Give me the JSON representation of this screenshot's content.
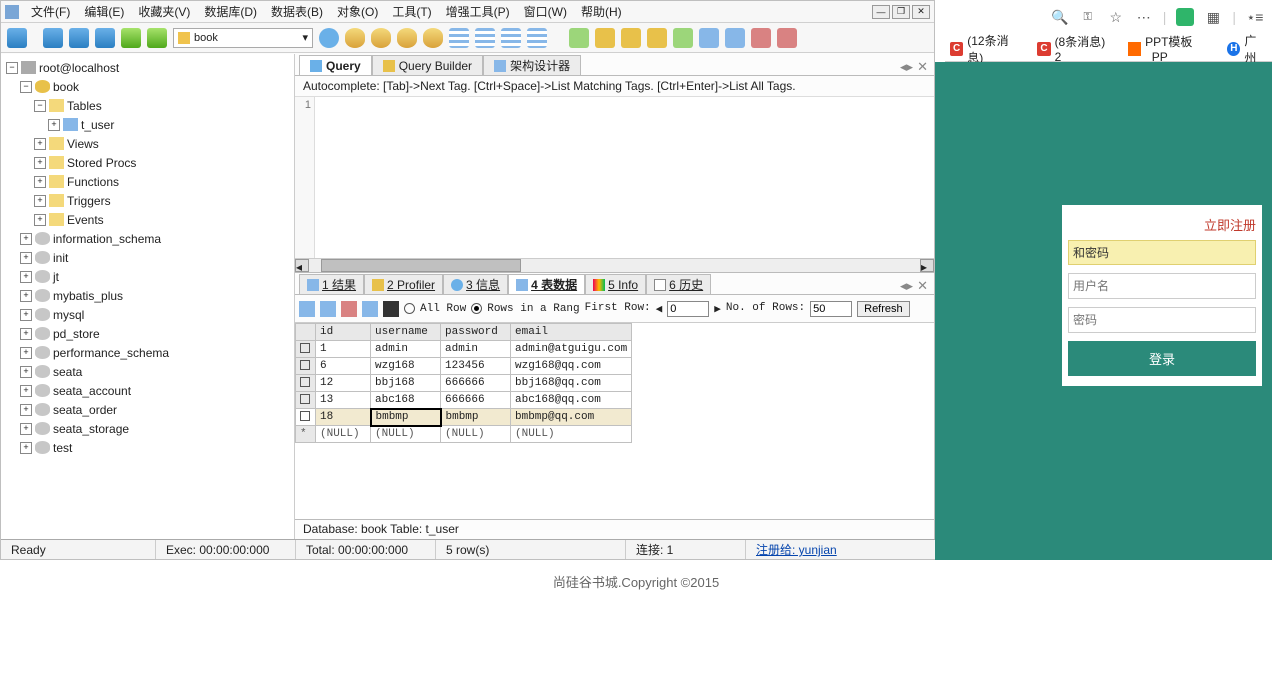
{
  "menu": {
    "file": "文件(F)",
    "edit": "编辑(E)",
    "fav": "收藏夹(V)",
    "database": "数据库(D)",
    "table": "数据表(B)",
    "object": "对象(O)",
    "tools": "工具(T)",
    "ptools": "增强工具(P)",
    "window": "窗口(W)",
    "help": "帮助(H)"
  },
  "combo_db": "book",
  "tree": {
    "root": "root@localhost",
    "db": "book",
    "tables": "Tables",
    "t_user": "t_user",
    "views": "Views",
    "sp": "Stored Procs",
    "functions": "Functions",
    "triggers": "Triggers",
    "events": "Events",
    "others": [
      "information_schema",
      "init",
      "jt",
      "mybatis_plus",
      "mysql",
      "pd_store",
      "performance_schema",
      "seata",
      "seata_account",
      "seata_order",
      "seata_storage",
      "test"
    ]
  },
  "tabs": {
    "query": "Query",
    "builder": "Query Builder",
    "arch": "架构设计器"
  },
  "hint": "Autocomplete: [Tab]->Next Tag. [Ctrl+Space]->List Matching Tags. [Ctrl+Enter]->List All Tags.",
  "gutter1": "1",
  "result_tabs": {
    "r1": "1 结果",
    "r2": "2 Profiler",
    "r3": "3 信息",
    "r4": "4 表数据",
    "r5": "5 Info",
    "r6": "6 历史"
  },
  "rowbar": {
    "allrow": "All Row",
    "rowsin": "Rows in a Rang",
    "first": "First Row:",
    "noof": "No. of Rows:",
    "val1": "0",
    "val2": "50",
    "refresh": "Refresh"
  },
  "grid": {
    "headers": [
      "id",
      "username",
      "password",
      "email"
    ],
    "rows": [
      {
        "id": "1",
        "username": "admin",
        "password": "admin",
        "email": "admin@atguigu.com"
      },
      {
        "id": "6",
        "username": "wzg168",
        "password": "123456",
        "email": "wzg168@qq.com"
      },
      {
        "id": "12",
        "username": "bbj168",
        "password": "666666",
        "email": "bbj168@qq.com"
      },
      {
        "id": "13",
        "username": "abc168",
        "password": "666666",
        "email": "abc168@qq.com"
      },
      {
        "id": "18",
        "username": "bmbmp",
        "password": "bmbmp",
        "email": "bmbmp@qq.com"
      }
    ],
    "nullrow": {
      "id": "(NULL)",
      "username": "(NULL)",
      "password": "(NULL)",
      "email": "(NULL)"
    }
  },
  "dbstatus": "Database: book Table: t_user",
  "status": {
    "ready": "Ready",
    "exec": "Exec: 00:00:00:000",
    "total": "Total: 00:00:00:000",
    "rows": "5 row(s)",
    "conn": "连接: 1",
    "regto": "注册给: yunjian"
  },
  "browser_tabs": [
    "(12条消息)",
    "(8条消息) 2",
    "PPT模板_PP",
    "广州"
  ],
  "login": {
    "reg": "立即注册",
    "msg": "和密码",
    "user_ph": "用户名",
    "pwd_ph": "密码",
    "btn": "登录"
  },
  "footer": "尚硅谷书城.Copyright ©2015"
}
